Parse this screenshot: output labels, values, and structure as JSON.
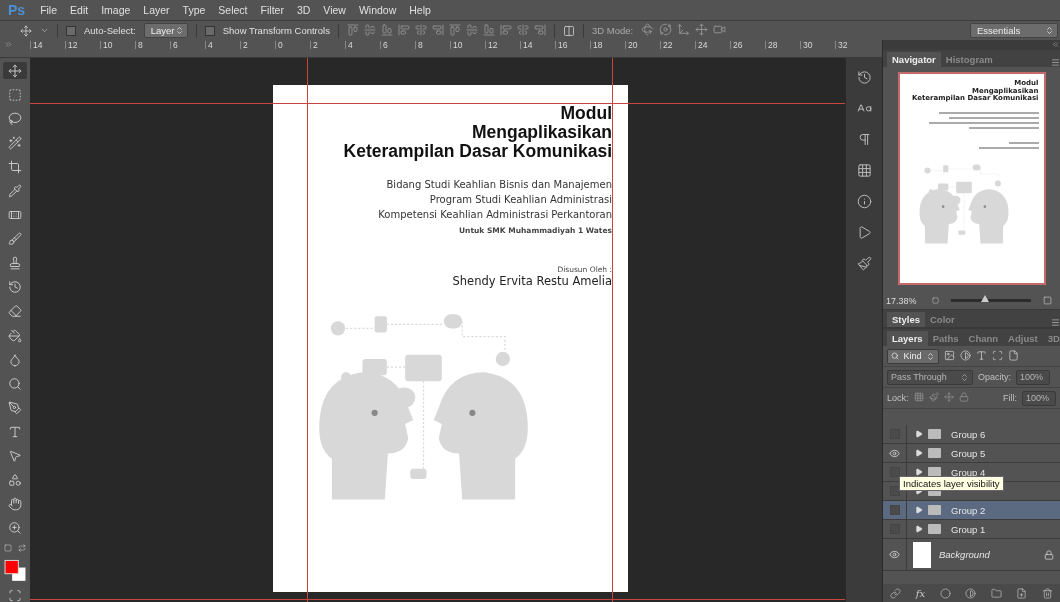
{
  "menu": {
    "logo": "Ps",
    "items": [
      "File",
      "Edit",
      "Image",
      "Layer",
      "Type",
      "Select",
      "Filter",
      "3D",
      "View",
      "Window",
      "Help"
    ]
  },
  "options": {
    "auto_select": {
      "label": "Auto-Select:",
      "checked": false
    },
    "target": "Layer",
    "show_transform": {
      "label": "Show Transform Controls",
      "checked": false
    },
    "mode_label": "3D Mode:",
    "workspace": "Essentials"
  },
  "ruler": {
    "marks": [
      "14",
      "12",
      "10",
      "8",
      "6",
      "4",
      "2",
      "0",
      "2",
      "4",
      "6",
      "8",
      "10",
      "12",
      "14",
      "16",
      "18",
      "20",
      "22",
      "24",
      "26",
      "28",
      "30",
      "32"
    ]
  },
  "toolbar": {
    "move_tool_selected": true
  },
  "document": {
    "title_lines": [
      "Modul",
      "Mengaplikasikan",
      "Keterampilan Dasar Komunikasi"
    ],
    "program_lines": [
      "Bidang Studi Keahlian Bisnis dan Manajemen",
      "Program Studi Keahlian Administrasi",
      "Kompetensi Keahlian Administrasi Perkantoran"
    ],
    "school": "Untuk SMK Muhammadiyah 1 Wates",
    "author_label": "Disusun Oleh :",
    "author": "Shendy Ervita Restu Amelia"
  },
  "navigator": {
    "tabs": [
      {
        "label": "Navigator",
        "selected": true
      },
      {
        "label": "Histogram",
        "selected": false
      }
    ],
    "preview_title_lines": [
      "Modul",
      "Mengaplikasikan",
      "Keterampilan Dasar Komunikasi"
    ],
    "zoom": "17.38%",
    "level": 0.42
  },
  "styles_tabs": [
    {
      "label": "Styles",
      "selected": true
    },
    {
      "label": "Color",
      "selected": false
    }
  ],
  "layers": {
    "tabs": [
      {
        "label": "Layers",
        "selected": true
      },
      {
        "label": "Paths",
        "selected": false
      },
      {
        "label": "Chann",
        "selected": false
      },
      {
        "label": "Adjust",
        "selected": false
      },
      {
        "label": "3D",
        "selected": false
      }
    ],
    "filter": "Kind",
    "blend_mode": "Pass Through",
    "opacity_label": "Opacity:",
    "opacity": "100%",
    "lock_label": "Lock:",
    "fill_label": "Fill:",
    "fill": "100%",
    "items": [
      {
        "kind": "group",
        "name": "Group 6",
        "visible": false,
        "selected": false
      },
      {
        "kind": "group",
        "name": "Group 5",
        "visible": true,
        "selected": false
      },
      {
        "kind": "group",
        "name": "Group 4",
        "visible": false,
        "selected": false
      },
      {
        "kind": "group",
        "visible": false,
        "selected": false
      },
      {
        "kind": "group",
        "name": "Group 2",
        "visible": false,
        "selected": true
      },
      {
        "kind": "group",
        "name": "Group 1",
        "visible": false,
        "selected": false
      },
      {
        "kind": "background",
        "name": "Background",
        "visible": true,
        "selected": false,
        "locked": true
      }
    ],
    "tooltip": "Indicates layer visibility",
    "effects_label": "fx"
  }
}
